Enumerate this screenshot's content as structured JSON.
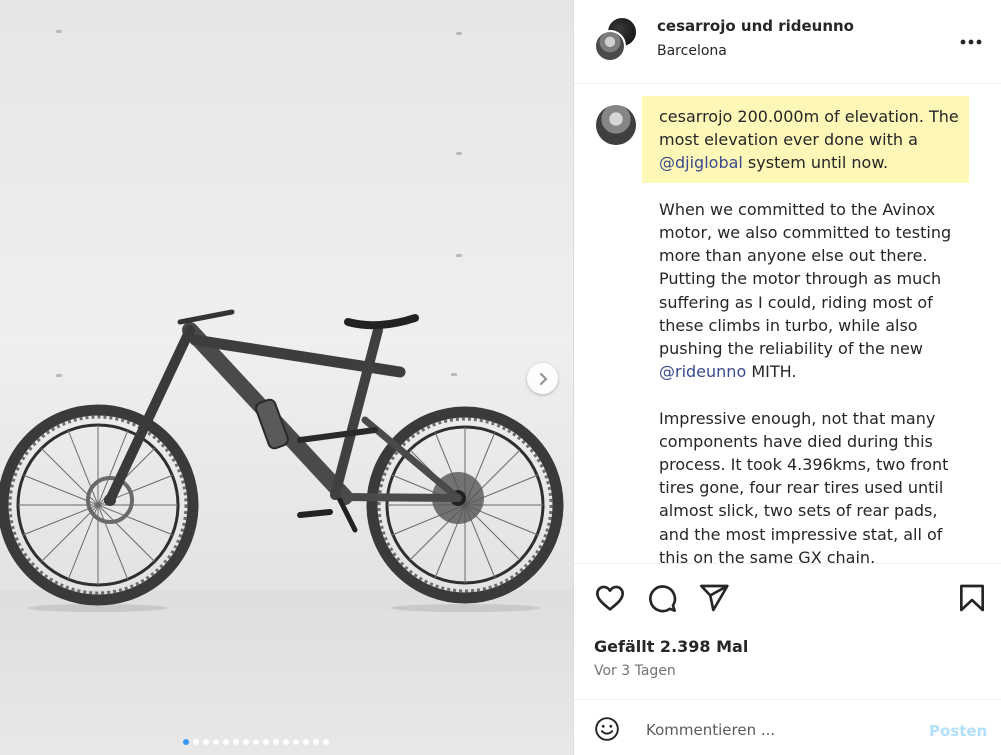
{
  "header": {
    "names": "cesarrojo und rideunno",
    "location": "Barcelona",
    "more_icon": "more-horizontal-icon"
  },
  "caption": {
    "username": "cesarrojo",
    "line1_text": " 200.000m of elevation. The most elevation ever done with a ",
    "mention1": "@djiglobal",
    "line1_tail": " system until now.",
    "para2_text": "When we committed to the Avinox motor, we also committed to testing more than anyone else out there. Putting the motor through as much suffering as I could, riding most of these climbs in turbo, while also pushing the reliability of the new ",
    "mention2": "@rideunno",
    "para2_tail": " MITH.",
    "para3_text": "Impressive enough, not that many components have died during this process. It took 4.396kms, two front tires gone, four rear tires used until almost slick, two sets of rear pads, and the most impressive stat, all of this on the same GX chain."
  },
  "actions": {
    "like_icon": "heart-icon",
    "comment_icon": "comment-icon",
    "share_icon": "send-icon",
    "save_icon": "bookmark-icon",
    "likes_text": "Gefällt 2.398 Mal",
    "time_text": "Vor 3 Tagen"
  },
  "comment": {
    "emoji_icon": "emoji-icon",
    "placeholder": "Kommentieren ...",
    "post_label": "Posten"
  },
  "carousel": {
    "next_icon": "chevron-right-icon",
    "slide_count": 15,
    "active_index": 0
  },
  "colors": {
    "highlight": "#fdf7b8",
    "mention": "#3a4a8c",
    "post_disabled": "#b2dffc"
  }
}
